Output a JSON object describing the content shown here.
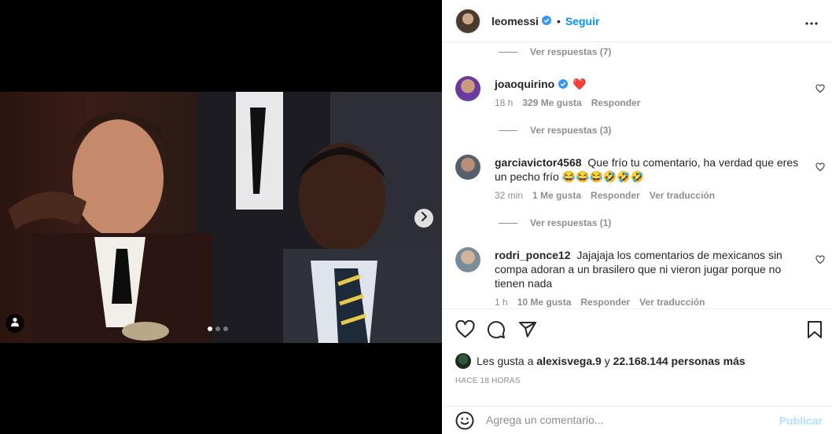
{
  "post": {
    "author": "leomessi",
    "follow_label": "Seguir",
    "bullet": "•"
  },
  "comments": {
    "replies_1": "Ver respuestas (7)",
    "c1": {
      "user": "joaoquirino",
      "text": "❤️",
      "time": "18 h",
      "likes": "329 Me gusta",
      "reply": "Responder"
    },
    "replies_2": "Ver respuestas (3)",
    "c2": {
      "user": "garciavictor4568",
      "text": "Que frío tu comentario, ha verdad que eres un pecho frío 😂😂😂🤣🤣🤣",
      "time": "32 min",
      "likes": "1 Me gusta",
      "reply": "Responder",
      "translate": "Ver traducción"
    },
    "replies_3": "Ver respuestas (1)",
    "c3": {
      "user": "rodri_ponce12",
      "text": "Jajajaja los comentarios de mexicanos sin compa adoran a un brasilero que ni vieron jugar porque no tienen nada",
      "time": "1 h",
      "likes": "10 Me gusta",
      "reply": "Responder",
      "translate": "Ver traducción"
    }
  },
  "likes_line": {
    "prefix": "Les gusta a",
    "user": "alexisvega.9",
    "connector": "y",
    "count": "22.168.144 personas más"
  },
  "timestamp": "HACE 18 HORAS",
  "add_comment": {
    "placeholder": "Agrega un comentario...",
    "publish_label": "Publicar"
  },
  "carousel": {
    "slides": 3,
    "active": 1
  },
  "colors": {
    "accent": "#0095f6",
    "verified": "#3897f0",
    "heart": "#ed4956",
    "muted": "#8e8e8e"
  },
  "icons": [
    "more-icon",
    "heart-icon",
    "comment-icon",
    "share-icon",
    "bookmark-icon",
    "emoji-icon",
    "chevron-right-icon",
    "user-tag-icon",
    "verified-icon"
  ]
}
